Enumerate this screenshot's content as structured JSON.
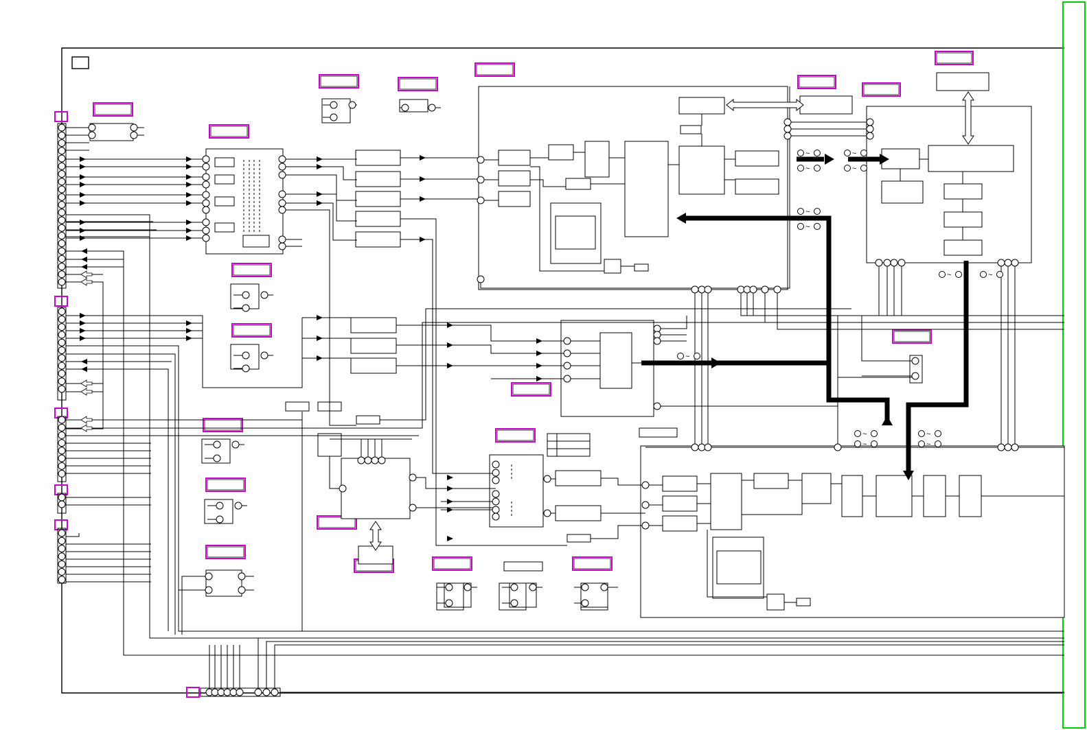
{
  "diagram": {
    "tilde_labels": [
      "~",
      "~",
      "~",
      "~",
      "~",
      "~",
      "~",
      "~",
      "~",
      "~",
      "~",
      "~",
      "~",
      "~",
      "~",
      "~",
      "~",
      "~"
    ],
    "colors": {
      "line": "#000000",
      "label_frame": "#cc00cc",
      "page_edge": "#00cc00",
      "background": "#ffffff"
    }
  }
}
